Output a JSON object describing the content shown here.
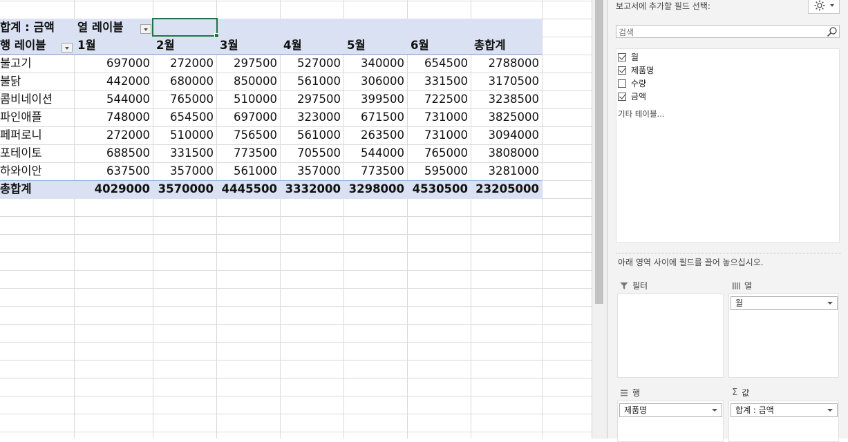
{
  "pivot": {
    "value_field_caption": "합계 : 금액",
    "column_labels_caption": "열 레이블",
    "row_labels_caption": "행 레이블",
    "columns": [
      "1월",
      "2월",
      "3월",
      "4월",
      "5월",
      "6월",
      "총합계"
    ],
    "rows": [
      {
        "label": "불고기",
        "values": [
          "697000",
          "272000",
          "297500",
          "527000",
          "340000",
          "654500",
          "2788000"
        ]
      },
      {
        "label": "불닭",
        "values": [
          "442000",
          "680000",
          "850000",
          "561000",
          "306000",
          "331500",
          "3170500"
        ]
      },
      {
        "label": "콤비네이션",
        "values": [
          "544000",
          "765000",
          "510000",
          "297500",
          "399500",
          "722500",
          "3238500"
        ]
      },
      {
        "label": "파인애플",
        "values": [
          "748000",
          "654500",
          "697000",
          "323000",
          "671500",
          "731000",
          "3825000"
        ]
      },
      {
        "label": "페퍼로니",
        "values": [
          "272000",
          "510000",
          "756500",
          "561000",
          "263500",
          "731000",
          "3094000"
        ]
      },
      {
        "label": "포테이토",
        "values": [
          "688500",
          "331500",
          "773500",
          "705500",
          "544000",
          "765000",
          "3808000"
        ]
      },
      {
        "label": "하와이안",
        "values": [
          "637500",
          "357000",
          "561000",
          "357000",
          "773500",
          "595000",
          "3281000"
        ]
      }
    ],
    "grand_total": {
      "label": "총합계",
      "values": [
        "4029000",
        "3570000",
        "4445500",
        "3332000",
        "3298000",
        "4530500",
        "23205000"
      ]
    }
  },
  "field_pane": {
    "choose_fields_label": "보고서에 추가할 필드 선택:",
    "settings_icon": "gear-icon",
    "search_placeholder": "검색",
    "fields": [
      {
        "name": "월",
        "checked": true
      },
      {
        "name": "제품명",
        "checked": true
      },
      {
        "name": "수량",
        "checked": false
      },
      {
        "name": "금액",
        "checked": true
      }
    ],
    "more_tables_label": "기타 테이블...",
    "drag_instruction": "아래 영역 사이에 필드를 끌어 놓으십시오.",
    "areas": {
      "filters": {
        "title": "필터",
        "items": []
      },
      "columns": {
        "title": "열",
        "items": [
          "월"
        ]
      },
      "rows": {
        "title": "행",
        "items": [
          "제품명"
        ]
      },
      "values": {
        "title": "값",
        "items": [
          "합계 : 금액"
        ]
      }
    }
  },
  "colors": {
    "pivot_band": "#d9e1f2",
    "pivot_border": "#8ea9db",
    "selection": "#217346",
    "gridline": "#d9d9d9",
    "pane_bg": "#f3f3f3"
  }
}
